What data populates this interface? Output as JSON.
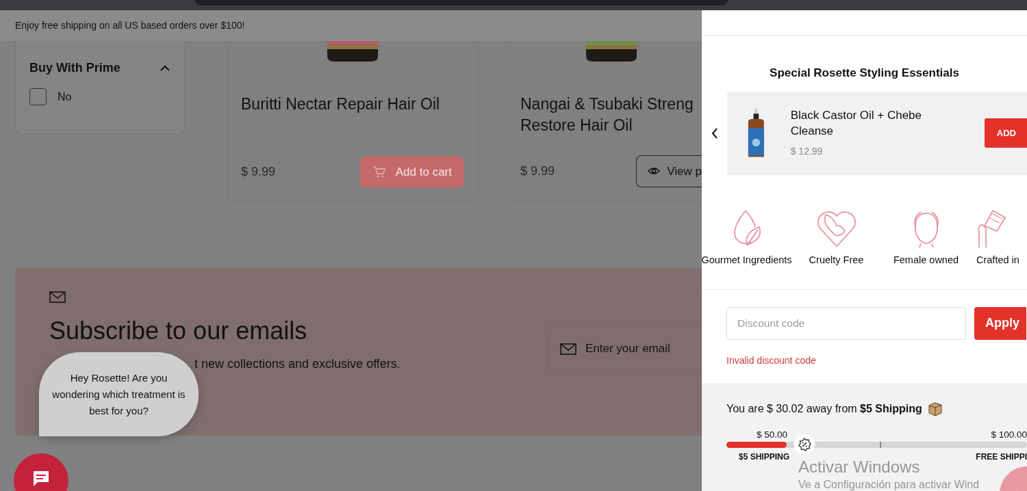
{
  "announcement": "Enjoy free shipping on all US based orders over $100!",
  "filter": {
    "title": "Buy With Prime",
    "expanded": true,
    "options": [
      {
        "label": "No",
        "checked": false
      }
    ]
  },
  "products": [
    {
      "title_lines": [
        "Buritti Nectar Repair Hair Oil"
      ],
      "price": "$ 9.99",
      "button": {
        "kind": "cart",
        "label": "Add to cart"
      }
    },
    {
      "title_lines": [
        "Nangai & Tsubaki Streng",
        "Restore Hair Oil"
      ],
      "price": "$ 9.99",
      "button": {
        "kind": "view",
        "label": "View p"
      }
    }
  ],
  "subscribe": {
    "title": "Subscribe to our emails",
    "text": "t new collections and exclusive offers.",
    "email_placeholder": "Enter your email"
  },
  "chat": {
    "message": "Hey Rosette! Are you wondering which treatment is best for you?"
  },
  "drawer": {
    "recommendations": {
      "title": "Special Rosette Styling Essentials",
      "items": [
        {
          "name": "Black Castor Oil + Chebe Cleanse",
          "price": "$ 12.99",
          "button": "ADD"
        }
      ]
    },
    "features": [
      {
        "label": "Gourmet Ingredients"
      },
      {
        "label": "Cruelty Free"
      },
      {
        "label": "Female owned"
      },
      {
        "label": "Crafted in"
      }
    ],
    "discount": {
      "placeholder": "Discount code",
      "button": "Apply",
      "error": "Invalid discount code"
    },
    "shipping": {
      "message": "You are $ 30.02 away from **$5 Shipping**",
      "level": 0.2,
      "milestones": [
        {
          "amount": "$ 50.00",
          "label": "$5 SHIPPING"
        },
        {
          "amount": "$ 100.00",
          "label": "FREE SHIPPI"
        }
      ]
    }
  },
  "os_notice": {
    "title": "Activar Windows",
    "text": "Ve a Configuración para activar Wind"
  }
}
